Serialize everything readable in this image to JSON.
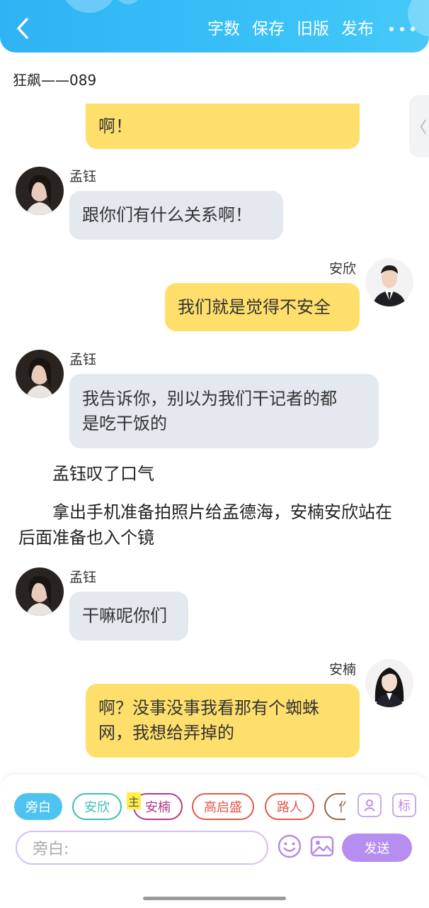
{
  "header": {
    "back_icon": "chevron-left-icon",
    "actions": [
      "字数",
      "保存",
      "旧版",
      "发布"
    ],
    "more_icon": "more-horizontal-icon",
    "color": "#38c0f7"
  },
  "document": {
    "title": "狂飙——089"
  },
  "side_tab": {
    "glyph": "〈"
  },
  "messages": [
    {
      "side": "right",
      "text": "啊！"
    },
    {
      "side": "left",
      "name": "孟钰",
      "text": "跟你们有什么关系啊！"
    },
    {
      "side": "right",
      "name": "安欣",
      "text": "我们就是觉得不安全"
    },
    {
      "side": "left",
      "name": "孟钰",
      "line1": "我告诉你，别以为我们干记者的都",
      "line2": "是吃干饭的"
    },
    {
      "type": "narration",
      "text": "孟钰叹了口气"
    },
    {
      "type": "narration",
      "text": "拿出手机准备拍照片给孟德海，安楠安欣站在后面准备也入个镜"
    },
    {
      "side": "left",
      "name": "孟钰",
      "text": "干嘛呢你们"
    },
    {
      "side": "right",
      "name": "安楠",
      "line1": "啊？没事没事我看那有个蜘蛛",
      "line2": "网，我想给弄掉的"
    }
  ],
  "roles": {
    "chips": [
      "旁白",
      "安欣",
      "安楠",
      "高启盛",
      "路人",
      "作"
    ],
    "main_tag": "主",
    "chip_colors": [
      "#4fc3f0",
      "#3dbfb0",
      "#b33a86",
      "#e05a4a",
      "#e05a4a",
      "#8a6a50"
    ]
  },
  "composer": {
    "placeholder": "旁白:",
    "send_label": "发送",
    "tag_button": "标",
    "accent": "#b68ef0"
  }
}
